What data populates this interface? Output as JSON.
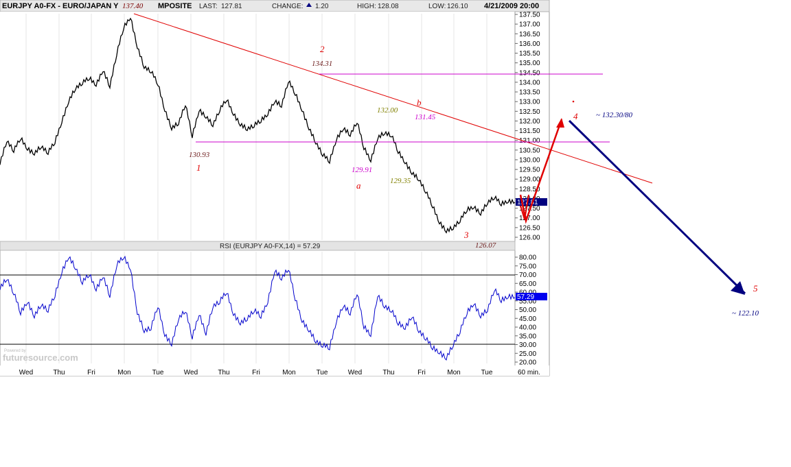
{
  "header": {
    "symbol": "EURJPY A0-FX - EURO/JAPAN Y",
    "symbol_tail": "MPOSITE",
    "last_label": "LAST:",
    "last_value": "127.81",
    "change_label": "CHANGE:",
    "change_value": "1.20",
    "high_label": "HIGH:",
    "high_value": "128.08",
    "low_label": "LOW:",
    "low_value": "126.10",
    "datetime": "4/21/2009 20:00"
  },
  "rsi_title": "RSI (EURJPY A0-FX,14) = 57.29",
  "interval_label": "60 min.",
  "watermark": "futuresource.com",
  "watermark_small": "Powered by",
  "colors": {
    "price": "#000000",
    "rsi": "#0000cc",
    "trend": "#e00000",
    "horizontal": "#cc00cc",
    "projection": "#000080",
    "accent_box": "#00007f"
  },
  "chart_data": [
    {
      "type": "line",
      "title": "",
      "ylabel": "",
      "xlabel": "",
      "ylim": [
        126.0,
        137.5
      ],
      "y_ticks": [
        "137.50",
        "137.00",
        "136.50",
        "136.00",
        "135.50",
        "135.00",
        "134.50",
        "134.00",
        "133.50",
        "133.00",
        "132.50",
        "132.00",
        "131.50",
        "131.00",
        "130.50",
        "130.00",
        "129.50",
        "129.00",
        "128.50",
        "128.00",
        "127.50",
        "127.00",
        "126.50",
        "126.00"
      ],
      "last_price_box": "127.81",
      "categories": [
        "Wed",
        "Thu",
        "Fri",
        "Mon",
        "Tue",
        "Wed",
        "Thu",
        "Fri",
        "Mon",
        "Tue",
        "Wed",
        "Thu",
        "Fri",
        "Mon",
        "Tue"
      ],
      "series": [
        {
          "x": [
            0,
            2,
            4,
            6,
            8,
            10,
            12,
            14,
            16,
            18,
            20,
            22,
            24,
            26,
            28,
            30,
            32,
            34,
            36,
            38,
            40,
            42,
            44,
            46,
            48,
            50,
            52,
            54,
            56,
            58,
            60,
            62,
            64,
            66,
            68,
            70,
            72,
            74,
            76,
            78,
            80,
            82,
            84,
            86,
            88,
            90,
            92,
            94,
            96,
            98,
            100,
            102,
            104,
            106,
            108,
            110,
            112,
            114,
            116,
            118,
            120,
            122,
            124,
            126,
            128,
            130,
            132,
            134,
            136,
            138,
            140,
            142,
            144,
            146,
            148,
            150
          ],
          "values": [
            129.8,
            131.0,
            130.5,
            131.1,
            130.6,
            130.3,
            130.7,
            130.4,
            130.9,
            132.0,
            133.0,
            133.7,
            134.0,
            134.2,
            133.9,
            134.6,
            133.8,
            135.5,
            136.8,
            137.4,
            135.8,
            134.8,
            134.6,
            133.9,
            132.6,
            131.6,
            131.9,
            132.9,
            131.2,
            132.6,
            132.2,
            131.8,
            132.6,
            133.1,
            132.4,
            131.8,
            131.6,
            131.8,
            132.0,
            132.4,
            133.0,
            132.8,
            134.1,
            133.4,
            132.6,
            131.6,
            130.9,
            130.3,
            129.9,
            131.1,
            131.6,
            131.3,
            132.0,
            130.6,
            130.0,
            131.1,
            131.4,
            131.3,
            130.4,
            129.9,
            129.3,
            129.0,
            128.4,
            127.6,
            126.8,
            126.3,
            126.5,
            126.9,
            127.4,
            127.6,
            127.2,
            127.8,
            128.1,
            127.7,
            127.9,
            127.8
          ]
        }
      ]
    },
    {
      "type": "line",
      "title": "RSI (EURJPY A0-FX,14) = 57.29",
      "ylim": [
        20,
        80
      ],
      "y_ticks": [
        "80.00",
        "75.00",
        "70.00",
        "65.00",
        "60.00",
        "55.00",
        "50.00",
        "45.00",
        "40.00",
        "35.00",
        "30.00",
        "25.00",
        "20.00"
      ],
      "reference_lines": [
        70,
        30
      ],
      "last_value_box": "57.29",
      "series": [
        {
          "x": [
            0,
            2,
            4,
            6,
            8,
            10,
            12,
            14,
            16,
            18,
            20,
            22,
            24,
            26,
            28,
            30,
            32,
            34,
            36,
            38,
            40,
            42,
            44,
            46,
            48,
            50,
            52,
            54,
            56,
            58,
            60,
            62,
            64,
            66,
            68,
            70,
            72,
            74,
            76,
            78,
            80,
            82,
            84,
            86,
            88,
            90,
            92,
            94,
            96,
            98,
            100,
            102,
            104,
            106,
            108,
            110,
            112,
            114,
            116,
            118,
            120,
            122,
            124,
            126,
            128,
            130,
            132,
            134,
            136,
            138,
            140,
            142,
            144,
            146,
            148,
            150
          ],
          "values": [
            62,
            68,
            60,
            48,
            55,
            46,
            53,
            50,
            58,
            72,
            80,
            74,
            66,
            70,
            62,
            69,
            58,
            76,
            80,
            74,
            48,
            38,
            40,
            52,
            36,
            30,
            45,
            50,
            34,
            48,
            36,
            52,
            55,
            60,
            48,
            42,
            45,
            50,
            46,
            55,
            72,
            68,
            74,
            56,
            44,
            38,
            32,
            30,
            28,
            44,
            52,
            48,
            60,
            40,
            36,
            58,
            52,
            50,
            42,
            40,
            46,
            38,
            34,
            28,
            26,
            22,
            30,
            38,
            48,
            54,
            46,
            50,
            62,
            55,
            58,
            57
          ]
        }
      ]
    }
  ],
  "annotations": {
    "peak": "137.40",
    "wave1_price": "130.93",
    "wave1_label": "1",
    "wave2_label": "2",
    "wave2_price": "134.31",
    "wave_a_price": "129.91",
    "wave_a_label": "a",
    "wave_b_label": "b",
    "wave_b_price": "131.45",
    "sub_high": "132.00",
    "sub_low": "129.35",
    "wave3_label": "3",
    "wave3_price": "126.07",
    "wave4_label": "4",
    "wave4_target": "~ 132.30/80",
    "wave5_label": "5",
    "wave5_target": "~ 122.10"
  }
}
